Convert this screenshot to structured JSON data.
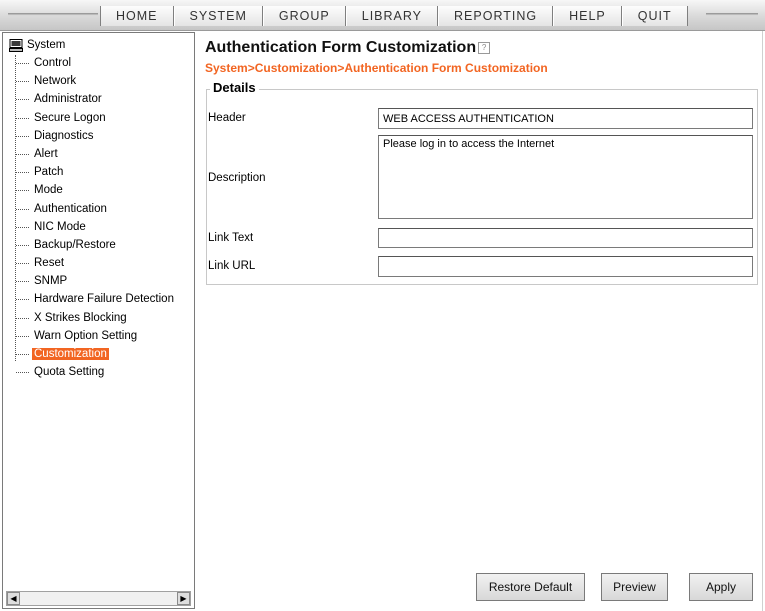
{
  "menu": {
    "items": [
      {
        "label": "HOME"
      },
      {
        "label": "SYSTEM"
      },
      {
        "label": "GROUP"
      },
      {
        "label": "LIBRARY"
      },
      {
        "label": "REPORTING"
      },
      {
        "label": "HELP"
      },
      {
        "label": "QUIT"
      }
    ]
  },
  "sidebar": {
    "root_label": "System",
    "root_icon": "computer-icon",
    "items": [
      {
        "label": "Control"
      },
      {
        "label": "Network"
      },
      {
        "label": "Administrator"
      },
      {
        "label": "Secure Logon"
      },
      {
        "label": "Diagnostics"
      },
      {
        "label": "Alert"
      },
      {
        "label": "Patch"
      },
      {
        "label": "Mode"
      },
      {
        "label": "Authentication"
      },
      {
        "label": "NIC Mode"
      },
      {
        "label": "Backup/Restore"
      },
      {
        "label": "Reset"
      },
      {
        "label": "SNMP"
      },
      {
        "label": "Hardware Failure Detection"
      },
      {
        "label": "X Strikes Blocking"
      },
      {
        "label": "Warn Option Setting"
      },
      {
        "label": "Customization",
        "selected": true
      },
      {
        "label": "Quota Setting"
      }
    ],
    "selected_color": "#f26522"
  },
  "page": {
    "title": "Authentication Form Customization",
    "help_icon": "help-icon",
    "breadcrumb": "System>Customization>Authentication Form Customization",
    "breadcrumb_color": "#f26522"
  },
  "details": {
    "legend": "Details",
    "header_label": "Header",
    "header_value": "WEB ACCESS AUTHENTICATION",
    "description_label": "Description",
    "description_value": "Please log in to access the Internet",
    "link_text_label": "Link Text",
    "link_text_value": "",
    "link_url_label": "Link URL",
    "link_url_value": ""
  },
  "buttons": {
    "restore_default": "Restore Default",
    "preview": "Preview",
    "apply": "Apply"
  }
}
